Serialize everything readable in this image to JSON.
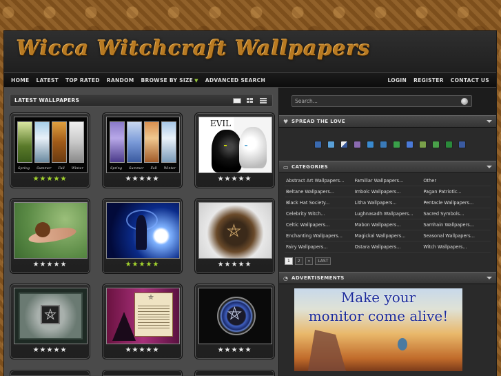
{
  "logo": "Wicca Witchcraft Wallpapers",
  "nav": {
    "left": [
      "HOME",
      "LATEST",
      "TOP RATED",
      "RANDOM",
      "BROWSE BY SIZE",
      "ADVANCED SEARCH"
    ],
    "right": [
      "LOGIN",
      "REGISTER",
      "CONTACT US"
    ]
  },
  "main": {
    "section_title": "LATEST WALLPAPERS",
    "thumbs": [
      {
        "stars_on": 5,
        "labels": [
          "Spring",
          "Summer",
          "Fall",
          "Winter"
        ]
      },
      {
        "stars_on": 0,
        "labels": [
          "Spring",
          "Summer",
          "Fall",
          "Winter"
        ]
      },
      {
        "stars_on": 0,
        "caption": "EVIL"
      },
      {
        "stars_on": 0
      },
      {
        "stars_on": 5
      },
      {
        "stars_on": 0
      },
      {
        "stars_on": 0
      },
      {
        "stars_on": 0
      },
      {
        "stars_on": 0
      }
    ]
  },
  "sidebar": {
    "search_placeholder": "Search...",
    "share_title": "SPREAD THE LOVE",
    "categories_title": "CATEGORIES",
    "categories": [
      [
        "Abstract Art Wallpapers...",
        "Familiar Wallpapers...",
        "Other"
      ],
      [
        "Beltane Wallpapers...",
        "Imbolc Wallpapers...",
        "Pagan Patriotic..."
      ],
      [
        "Black Hat Society...",
        "Litha Wallpapers...",
        "Pentacle Wallpapers..."
      ],
      [
        "Celebrity Witch...",
        "Lughnasadh Wallpapers...",
        "Sacred Symbols..."
      ],
      [
        "Celtic Wallpapers...",
        "Mabon Wallpapers...",
        "Samhain Wallpapers..."
      ],
      [
        "Enchanting Wallpapers...",
        "Magickal Wallpapers...",
        "Seasonal Wallpapers..."
      ],
      [
        "Fairy Wallpapers...",
        "Ostara Wallpapers...",
        "Witch Wallpapers..."
      ]
    ],
    "pager": [
      "1",
      "2",
      "»",
      "LAST"
    ],
    "ads_title": "ADVERTISEMENTS",
    "ad_text": [
      "Make your",
      "monitor come alive!"
    ]
  },
  "colors": {
    "star_on": "#a4d42e",
    "nav_caret": "#9ccc3c",
    "ad_text": "#1a2a9a"
  }
}
